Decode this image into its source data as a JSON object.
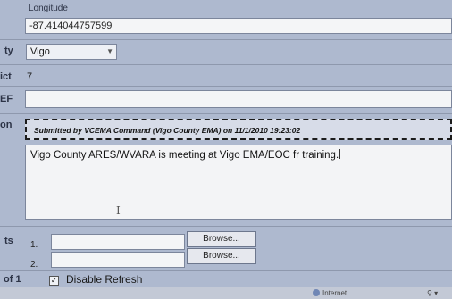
{
  "longitude": {
    "label": "Longitude",
    "value": "-87.414044757599"
  },
  "county": {
    "label_fragment": "ty",
    "selected": "Vigo"
  },
  "ict": {
    "label_fragment": "ict",
    "value": "7"
  },
  "ef": {
    "label_fragment": "EF",
    "value": ""
  },
  "description": {
    "label_fragment": "on",
    "submitted_note": "Submitted by VCEMA Command (Vigo County EMA) on 11/1/2010 19:23:02",
    "text": "Vigo County ARES/WVARA is meeting at Vigo EMA/EOC fr training."
  },
  "attachments": {
    "label_fragment": "ts",
    "rows": [
      {
        "number": "1.",
        "browse_label": "Browse..."
      },
      {
        "number": "2.",
        "browse_label": "Browse..."
      }
    ]
  },
  "footer": {
    "page_fragment": "of 1",
    "disable_refresh_label": "Disable Refresh",
    "disable_refresh_checked": true,
    "check_mark": "✓"
  },
  "statusbar": {
    "zone": "Internet",
    "zoom": "⚲ ▾"
  }
}
